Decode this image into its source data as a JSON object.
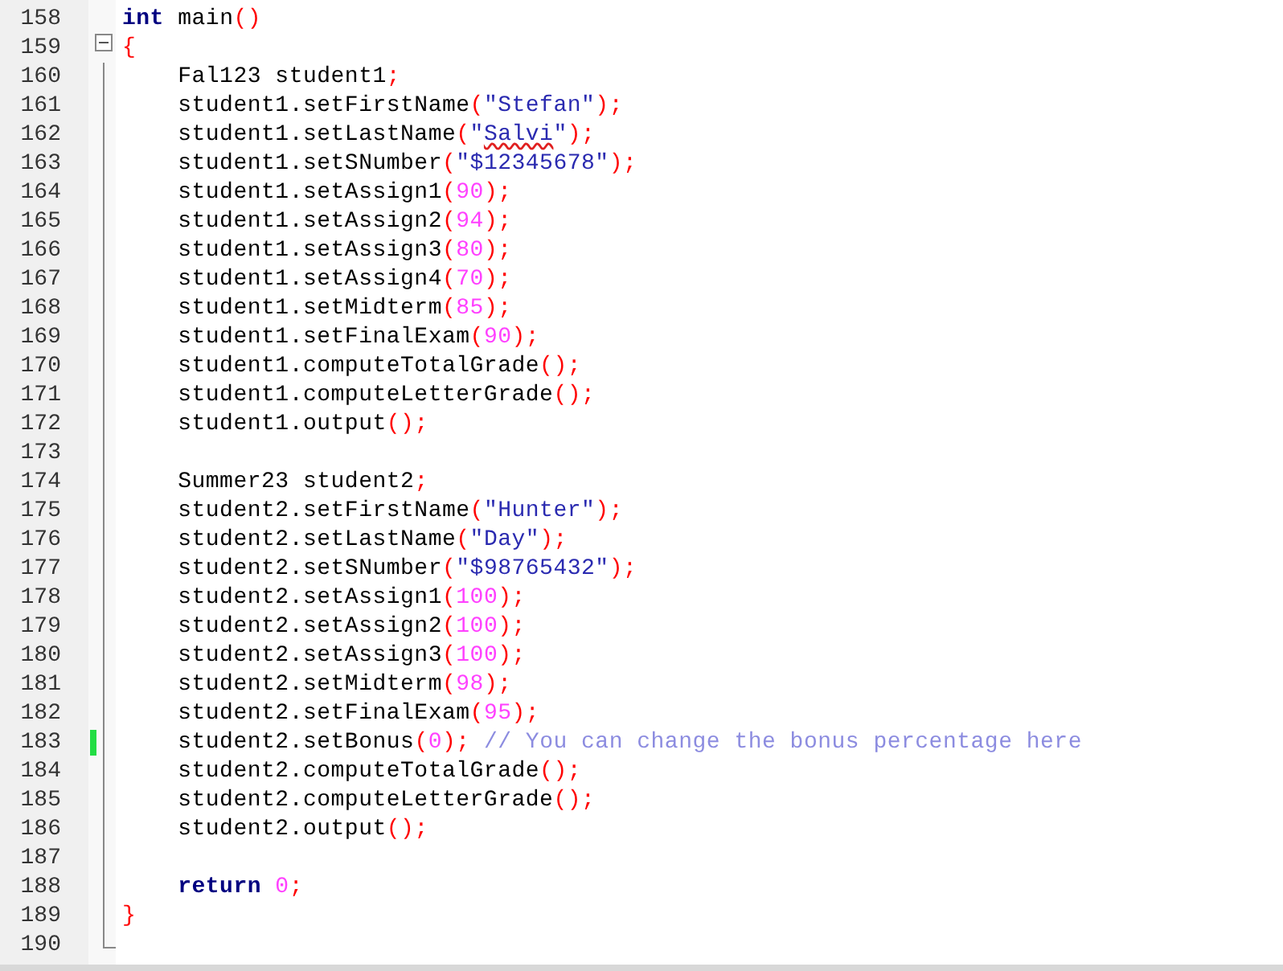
{
  "lines": [
    {
      "number": "158",
      "changed": false,
      "code": [
        {
          "kind": "kw",
          "t": "int"
        },
        {
          "kind": "id",
          "t": " main"
        },
        {
          "kind": "op",
          "t": "()"
        }
      ]
    },
    {
      "number": "159",
      "fold_start": true,
      "changed": false,
      "code": [
        {
          "kind": "op",
          "t": "{"
        }
      ]
    },
    {
      "number": "160",
      "changed": false,
      "code": [
        {
          "kind": "id",
          "t": "    Fal123 student1"
        },
        {
          "kind": "op",
          "t": ";"
        }
      ]
    },
    {
      "number": "161",
      "changed": false,
      "code": [
        {
          "kind": "id",
          "t": "    student1.setFirstName"
        },
        {
          "kind": "op",
          "t": "("
        },
        {
          "kind": "str",
          "t": "\"Stefan\""
        },
        {
          "kind": "op",
          "t": ");"
        }
      ]
    },
    {
      "number": "162",
      "changed": false,
      "code": [
        {
          "kind": "id",
          "t": "    student1.setLastName"
        },
        {
          "kind": "op",
          "t": "("
        },
        {
          "kind": "str",
          "t": "\""
        },
        {
          "kind": "misspelled",
          "t": "Salvi"
        },
        {
          "kind": "str",
          "t": "\""
        },
        {
          "kind": "op",
          "t": ");"
        }
      ]
    },
    {
      "number": "163",
      "changed": false,
      "code": [
        {
          "kind": "id",
          "t": "    student1.setSNumber"
        },
        {
          "kind": "op",
          "t": "("
        },
        {
          "kind": "str",
          "t": "\"$12345678\""
        },
        {
          "kind": "op",
          "t": ");"
        }
      ]
    },
    {
      "number": "164",
      "changed": false,
      "code": [
        {
          "kind": "id",
          "t": "    student1.setAssign1"
        },
        {
          "kind": "op",
          "t": "("
        },
        {
          "kind": "num",
          "t": "90"
        },
        {
          "kind": "op",
          "t": ");"
        }
      ]
    },
    {
      "number": "165",
      "changed": false,
      "code": [
        {
          "kind": "id",
          "t": "    student1.setAssign2"
        },
        {
          "kind": "op",
          "t": "("
        },
        {
          "kind": "num",
          "t": "94"
        },
        {
          "kind": "op",
          "t": ");"
        }
      ]
    },
    {
      "number": "166",
      "changed": false,
      "code": [
        {
          "kind": "id",
          "t": "    student1.setAssign3"
        },
        {
          "kind": "op",
          "t": "("
        },
        {
          "kind": "num",
          "t": "80"
        },
        {
          "kind": "op",
          "t": ");"
        }
      ]
    },
    {
      "number": "167",
      "changed": false,
      "code": [
        {
          "kind": "id",
          "t": "    student1.setAssign4"
        },
        {
          "kind": "op",
          "t": "("
        },
        {
          "kind": "num",
          "t": "70"
        },
        {
          "kind": "op",
          "t": ");"
        }
      ]
    },
    {
      "number": "168",
      "changed": false,
      "code": [
        {
          "kind": "id",
          "t": "    student1.setMidterm"
        },
        {
          "kind": "op",
          "t": "("
        },
        {
          "kind": "num",
          "t": "85"
        },
        {
          "kind": "op",
          "t": ");"
        }
      ]
    },
    {
      "number": "169",
      "changed": false,
      "code": [
        {
          "kind": "id",
          "t": "    student1.setFinalExam"
        },
        {
          "kind": "op",
          "t": "("
        },
        {
          "kind": "num",
          "t": "90"
        },
        {
          "kind": "op",
          "t": ");"
        }
      ]
    },
    {
      "number": "170",
      "changed": false,
      "code": [
        {
          "kind": "id",
          "t": "    student1.computeTotalGrade"
        },
        {
          "kind": "op",
          "t": "();"
        }
      ]
    },
    {
      "number": "171",
      "changed": false,
      "code": [
        {
          "kind": "id",
          "t": "    student1.computeLetterGrade"
        },
        {
          "kind": "op",
          "t": "();"
        }
      ]
    },
    {
      "number": "172",
      "changed": false,
      "code": [
        {
          "kind": "id",
          "t": "    student1.output"
        },
        {
          "kind": "op",
          "t": "();"
        }
      ]
    },
    {
      "number": "173",
      "changed": false
    },
    {
      "number": "174",
      "changed": false,
      "code": [
        {
          "kind": "id",
          "t": "    Summer23 student2"
        },
        {
          "kind": "op",
          "t": ";"
        }
      ]
    },
    {
      "number": "175",
      "changed": false,
      "code": [
        {
          "kind": "id",
          "t": "    student2.setFirstName"
        },
        {
          "kind": "op",
          "t": "("
        },
        {
          "kind": "str",
          "t": "\"Hunter\""
        },
        {
          "kind": "op",
          "t": ");"
        }
      ]
    },
    {
      "number": "176",
      "changed": false,
      "code": [
        {
          "kind": "id",
          "t": "    student2.setLastName"
        },
        {
          "kind": "op",
          "t": "("
        },
        {
          "kind": "str",
          "t": "\"Day\""
        },
        {
          "kind": "op",
          "t": ");"
        }
      ]
    },
    {
      "number": "177",
      "changed": false,
      "code": [
        {
          "kind": "id",
          "t": "    student2.setSNumber"
        },
        {
          "kind": "op",
          "t": "("
        },
        {
          "kind": "str",
          "t": "\"$98765432\""
        },
        {
          "kind": "op",
          "t": ");"
        }
      ]
    },
    {
      "number": "178",
      "changed": false,
      "code": [
        {
          "kind": "id",
          "t": "    student2.setAssign1"
        },
        {
          "kind": "op",
          "t": "("
        },
        {
          "kind": "num",
          "t": "100"
        },
        {
          "kind": "op",
          "t": ");"
        }
      ]
    },
    {
      "number": "179",
      "changed": false,
      "code": [
        {
          "kind": "id",
          "t": "    student2.setAssign2"
        },
        {
          "kind": "op",
          "t": "("
        },
        {
          "kind": "num",
          "t": "100"
        },
        {
          "kind": "op",
          "t": ");"
        }
      ]
    },
    {
      "number": "180",
      "changed": false,
      "code": [
        {
          "kind": "id",
          "t": "    student2.setAssign3"
        },
        {
          "kind": "op",
          "t": "("
        },
        {
          "kind": "num",
          "t": "100"
        },
        {
          "kind": "op",
          "t": ");"
        }
      ]
    },
    {
      "number": "181",
      "changed": false,
      "code": [
        {
          "kind": "id",
          "t": "    student2.setMidterm"
        },
        {
          "kind": "op",
          "t": "("
        },
        {
          "kind": "num",
          "t": "98"
        },
        {
          "kind": "op",
          "t": ");"
        }
      ]
    },
    {
      "number": "182",
      "changed": false,
      "code": [
        {
          "kind": "id",
          "t": "    student2.setFinalExam"
        },
        {
          "kind": "op",
          "t": "("
        },
        {
          "kind": "num",
          "t": "95"
        },
        {
          "kind": "op",
          "t": ");"
        }
      ]
    },
    {
      "number": "183",
      "changed": true,
      "code": [
        {
          "kind": "id",
          "t": "    student2.setBonus"
        },
        {
          "kind": "op",
          "t": "("
        },
        {
          "kind": "num",
          "t": "0"
        },
        {
          "kind": "op",
          "t": ");"
        },
        {
          "kind": "comment",
          "t": " // You can change the bonus percentage here"
        }
      ]
    },
    {
      "number": "184",
      "changed": false,
      "code": [
        {
          "kind": "id",
          "t": "    student2.computeTotalGrade"
        },
        {
          "kind": "op",
          "t": "();"
        }
      ]
    },
    {
      "number": "185",
      "changed": false,
      "code": [
        {
          "kind": "id",
          "t": "    student2.computeLetterGrade"
        },
        {
          "kind": "op",
          "t": "();"
        }
      ]
    },
    {
      "number": "186",
      "changed": false,
      "code": [
        {
          "kind": "id",
          "t": "    student2.output"
        },
        {
          "kind": "op",
          "t": "();"
        }
      ]
    },
    {
      "number": "187",
      "changed": false
    },
    {
      "number": "188",
      "changed": false,
      "code": [
        {
          "kind": "kw",
          "t": "    return"
        },
        {
          "kind": "num",
          "t": " 0"
        },
        {
          "kind": "op",
          "t": ";"
        }
      ]
    },
    {
      "number": "189",
      "changed": false,
      "code": [
        {
          "kind": "op",
          "t": "}"
        }
      ]
    },
    {
      "number": "190",
      "fold_end": true,
      "changed": false
    }
  ]
}
